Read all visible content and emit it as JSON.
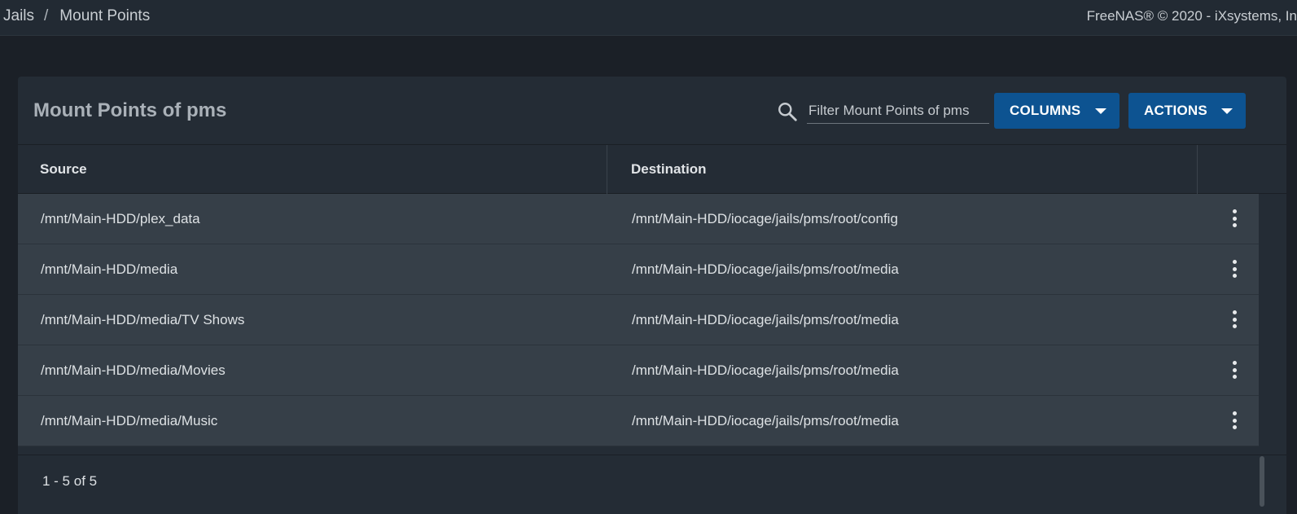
{
  "topbar": {
    "breadcrumb": [
      {
        "label": "Jails"
      },
      {
        "label": "Mount Points"
      }
    ],
    "breadcrumb_separator": "/",
    "copyright": "FreeNAS® © 2020 - iXsystems, In"
  },
  "card": {
    "title": "Mount Points of pms",
    "search": {
      "placeholder": "Filter Mount Points of pms",
      "value": "",
      "icon": "search-icon"
    },
    "columns_button": "COLUMNS",
    "actions_button": "ACTIONS",
    "table": {
      "headers": {
        "source": "Source",
        "destination": "Destination"
      },
      "rows": [
        {
          "source": "/mnt/Main-HDD/plex_data",
          "destination": "/mnt/Main-HDD/iocage/jails/pms/root/config"
        },
        {
          "source": "/mnt/Main-HDD/media",
          "destination": "/mnt/Main-HDD/iocage/jails/pms/root/media"
        },
        {
          "source": "/mnt/Main-HDD/media/TV Shows",
          "destination": "/mnt/Main-HDD/iocage/jails/pms/root/media"
        },
        {
          "source": "/mnt/Main-HDD/media/Movies",
          "destination": "/mnt/Main-HDD/iocage/jails/pms/root/media"
        },
        {
          "source": "/mnt/Main-HDD/media/Music",
          "destination": "/mnt/Main-HDD/iocage/jails/pms/root/media"
        }
      ]
    },
    "paginator": "1 - 5 of 5"
  },
  "colors": {
    "background": "#1b2027",
    "topbar": "#222a33",
    "card": "#242c35",
    "row": "#363f48",
    "button": "#0d5391"
  }
}
